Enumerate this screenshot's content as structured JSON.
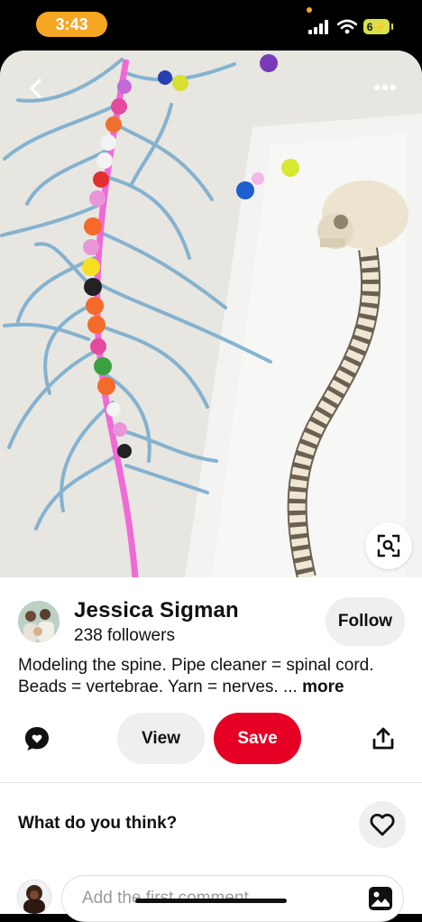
{
  "status": {
    "time": "3:43",
    "battery": "6⚡",
    "colors": {
      "time_pill": "#f5a623",
      "battery": "#d8e04a"
    }
  },
  "pin": {
    "icons": {
      "back": "chevron-left-icon",
      "more": "more-horizontal-icon",
      "lens": "visual-search-icon"
    }
  },
  "creator": {
    "name": "Jessica Sigman",
    "followers": "238 followers",
    "follow_label": "Follow"
  },
  "description": {
    "text": "Modeling the spine. Pipe cleaner = spinal cord. Beads = vertebrae. Yarn = nerves. ... ",
    "more": "more"
  },
  "actions": {
    "view_label": "View",
    "save_label": "Save",
    "icons": {
      "comment": "comment-bubble-icon",
      "share": "share-icon"
    }
  },
  "comments": {
    "prompt": "What do you think?",
    "placeholder": "Add the first comment",
    "icons": {
      "heart": "heart-icon",
      "image": "image-icon"
    }
  },
  "colors": {
    "save": "#e60023",
    "pill_gray": "#efefef"
  }
}
